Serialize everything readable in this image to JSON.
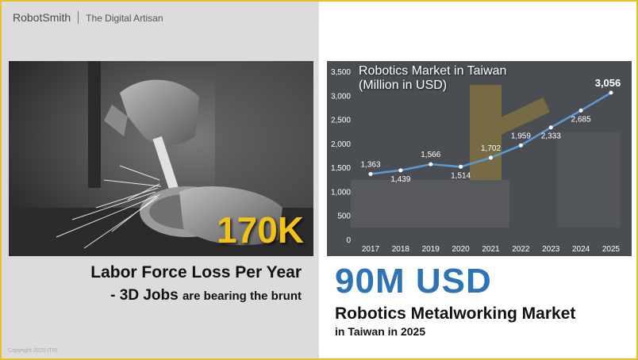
{
  "header": {
    "brand_name": "RobotSmith",
    "tagline": "The Digital Artisan"
  },
  "left_panel": {
    "stat": "170K",
    "caption_line1": "Labor Force Loss Per Year",
    "caption_line2_main": "- 3D Jobs",
    "caption_line2_small": "are bearing the brunt",
    "copyright": "Copyright 2020 ITRI"
  },
  "right_panel": {
    "stat": "90M USD",
    "caption_line1": "Robotics Metalworking Market",
    "caption_line2": "in Taiwan in 2025"
  },
  "chart_data": {
    "type": "line",
    "title": "Robotics Market in Taiwan",
    "subtitle": "(Million in USD)",
    "x": [
      "2017",
      "2018",
      "2019",
      "2020",
      "2021",
      "2022",
      "2023",
      "2024",
      "2025"
    ],
    "values": [
      1363,
      1439,
      1566,
      1514,
      1702,
      1959,
      2333,
      2685,
      3056
    ],
    "data_labels": [
      "1,363",
      "1,439",
      "1,566",
      "1,514",
      "1,702",
      "1,959",
      "2,333",
      "2,685",
      "3,056"
    ],
    "yticks": [
      "0",
      "500",
      "1,000",
      "1,500",
      "2,000",
      "2,500",
      "3,000",
      "3,500"
    ],
    "ylim": [
      0,
      3500
    ],
    "grid": false,
    "line_color": "#5b9bd5",
    "point_color": "#ffffff"
  },
  "colors": {
    "frame": "#e6c12a",
    "stat_yellow": "#f2c316",
    "stat_blue": "#2e74b5"
  }
}
